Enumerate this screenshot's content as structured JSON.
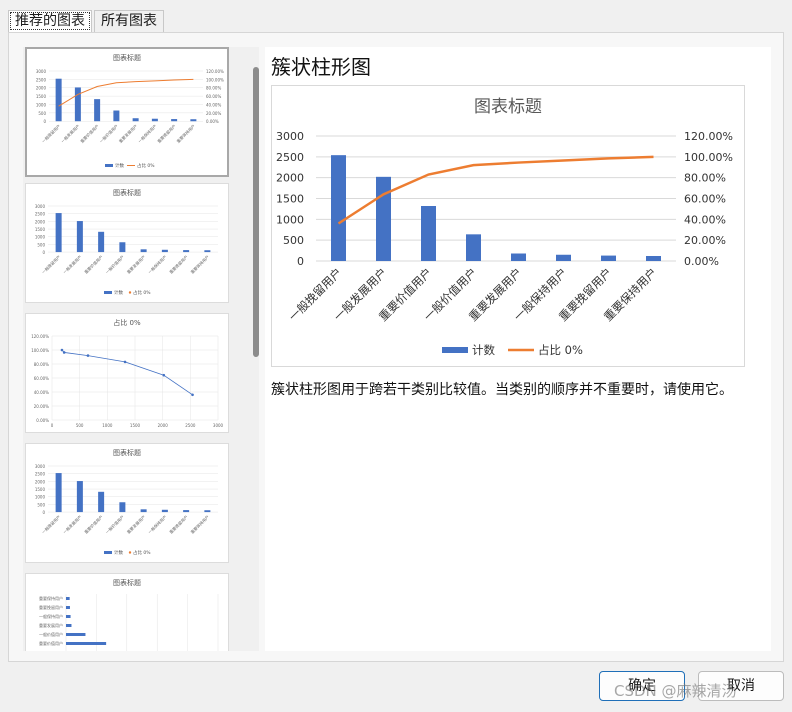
{
  "tabs": [
    {
      "label": "推荐的图表"
    },
    {
      "label": "所有图表"
    }
  ],
  "thumbnails": [
    {
      "title": "图表标题",
      "kind": "combo"
    },
    {
      "title": "图表标题",
      "kind": "bar"
    },
    {
      "title": "占比 0%",
      "kind": "scatter"
    },
    {
      "title": "图表标题",
      "kind": "bar"
    },
    {
      "title": "图表标题",
      "kind": "hbar"
    }
  ],
  "preview": {
    "heading": "簇状柱形图",
    "description": "簇状柱形图用于跨若干类别比较值。当类别的顺序并不重要时，请使用它。"
  },
  "chart_data": {
    "type": "bar",
    "title": "图表标题",
    "categories": [
      "一般挽留用户",
      "一般发展用户",
      "重要价值用户",
      "一般价值用户",
      "重要发展用户",
      "一般保持用户",
      "重要挽留用户",
      "重要保持用户"
    ],
    "series": [
      {
        "name": "计数",
        "type": "bar",
        "axis": "left",
        "values": [
          2540,
          2020,
          1320,
          640,
          180,
          150,
          130,
          120
        ],
        "color": "#4472c4"
      },
      {
        "name": "占比 0%",
        "type": "line",
        "axis": "right",
        "values": [
          0.36,
          0.64,
          0.83,
          0.92,
          0.945,
          0.965,
          0.985,
          1.0
        ],
        "color": "#ed7d31"
      }
    ],
    "y_left": {
      "ticks": [
        "0",
        "500",
        "1000",
        "1500",
        "2000",
        "2500",
        "3000"
      ],
      "range": [
        0,
        3000
      ]
    },
    "y_right": {
      "ticks": [
        "0.00%",
        "20.00%",
        "40.00%",
        "60.00%",
        "80.00%",
        "100.00%",
        "120.00%"
      ],
      "range": [
        0,
        1.2
      ]
    },
    "legend_position": "bottom",
    "grid": true
  },
  "scatter_thumb": {
    "x": [
      180,
      220,
      650,
      1320,
      2020,
      2540
    ],
    "y": [
      1.0,
      0.985,
      0.965,
      0.945,
      0.92,
      0.83
    ],
    "note_y_ticks": [
      "0.00%",
      "20.00%",
      "40.00%",
      "60.00%",
      "80.00%",
      "100.00%",
      "120.00%"
    ],
    "x_ticks": [
      "0",
      "500",
      "1000",
      "1500",
      "2000",
      "2500",
      "3000"
    ]
  },
  "buttons": {
    "ok": "确定",
    "cancel": "取消"
  },
  "watermark": "CSDN @麻辣清汤"
}
